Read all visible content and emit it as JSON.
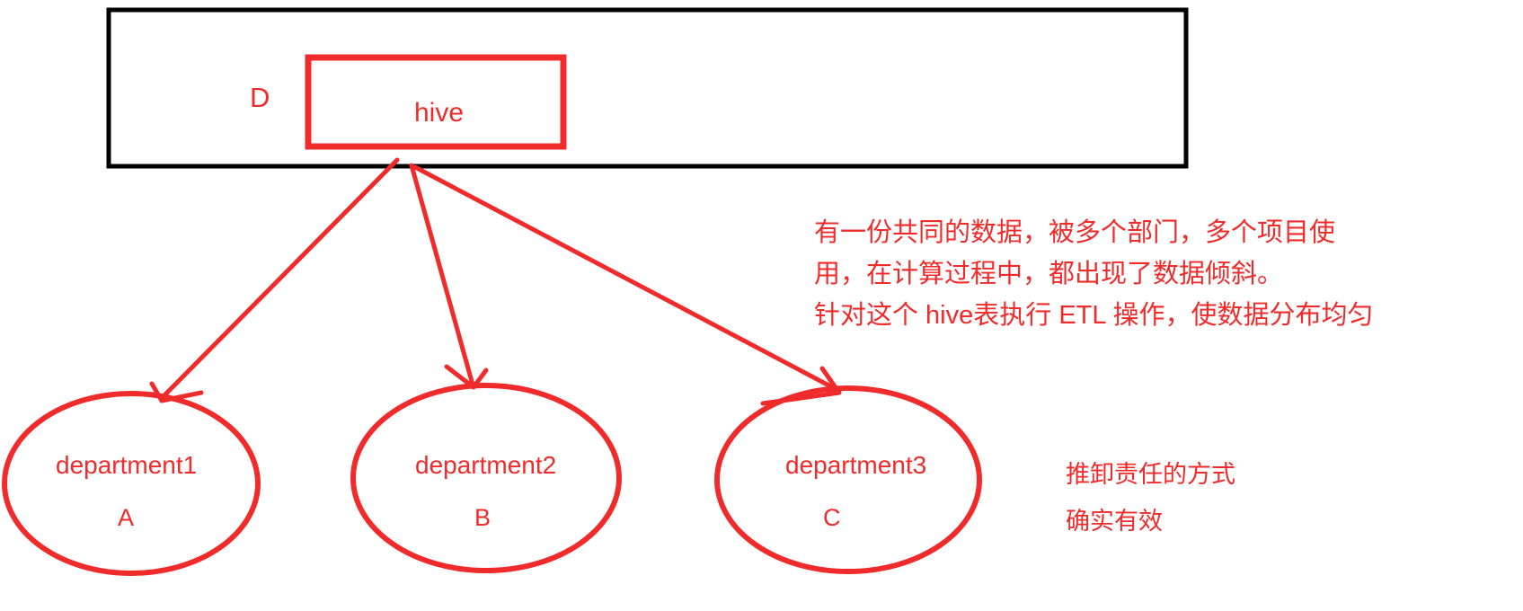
{
  "diagram": {
    "title_label": "D",
    "source_box": {
      "label": "hive"
    },
    "nodes": [
      {
        "name": "department1",
        "letter": "A"
      },
      {
        "name": "department2",
        "letter": "B"
      },
      {
        "name": "department3",
        "letter": "C"
      }
    ],
    "notes": {
      "main": [
        "有一份共同的数据，被多个部门，多个项目使",
        "用，在计算过程中，都出现了数据倾斜。",
        "针对这个 hive表执行 ETL 操作，使数据分布均匀"
      ],
      "bottom": [
        "推卸责任的方式",
        "确实有效"
      ]
    },
    "colors": {
      "ink_red": "#f02b2b",
      "outer_box_border": "#000000",
      "background": "#ffffff"
    }
  }
}
